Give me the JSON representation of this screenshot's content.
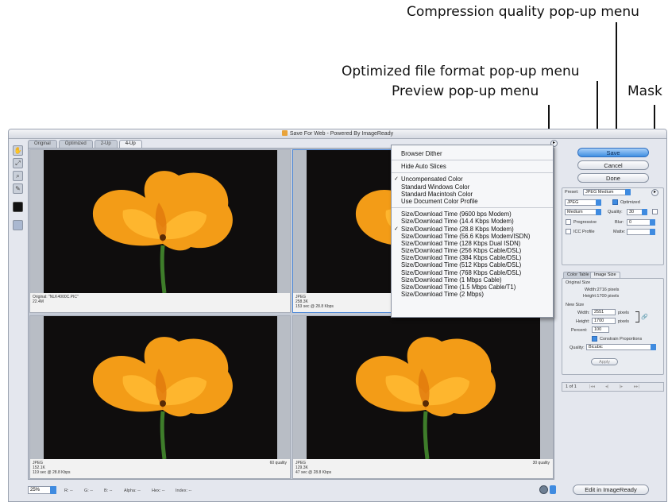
{
  "callouts": {
    "compression": "Compression quality pop-up menu",
    "format": "Optimized file format pop-up menu",
    "preview": "Preview pop-up menu",
    "mask": "Mask"
  },
  "window": {
    "title": "Save For Web - Powered By ImageReady"
  },
  "tabs": [
    "Original",
    "Optimized",
    "2-Up",
    "4-Up"
  ],
  "active_tab": "4-Up",
  "panes": [
    {
      "info_lines": [
        "Original: \"NLK4000C.PIC\"",
        "22.4M"
      ],
      "quality": ""
    },
    {
      "info_lines": [
        "JPEG",
        "258.3K",
        "153 sec @ 28.8 Kbps"
      ],
      "quality": ""
    },
    {
      "info_lines": [
        "JPEG",
        "152.1K",
        "119 sec @ 28.8 Kbps"
      ],
      "quality": "60 quality"
    },
    {
      "info_lines": [
        "JPEG",
        "129.3K",
        "47 sec @ 28.8 Kbps"
      ],
      "quality": "30 quality"
    }
  ],
  "preview_menu": {
    "group1": [
      {
        "label": "Browser Dither",
        "checked": false
      }
    ],
    "group2": [
      {
        "label": "Hide Auto Slices",
        "checked": false
      }
    ],
    "group3": [
      {
        "label": "Uncompensated Color",
        "checked": true
      },
      {
        "label": "Standard Windows Color",
        "checked": false
      },
      {
        "label": "Standard Macintosh Color",
        "checked": false
      },
      {
        "label": "Use Document Color Profile",
        "checked": false
      }
    ],
    "group4": [
      {
        "label": "Size/Download Time (9600 bps Modem)",
        "checked": false
      },
      {
        "label": "Size/Download Time (14.4 Kbps Modem)",
        "checked": false
      },
      {
        "label": "Size/Download Time (28.8 Kbps Modem)",
        "checked": true
      },
      {
        "label": "Size/Download Time (56.6 Kbps Modem/ISDN)",
        "checked": false
      },
      {
        "label": "Size/Download Time (128 Kbps Dual ISDN)",
        "checked": false
      },
      {
        "label": "Size/Download Time (256 Kbps Cable/DSL)",
        "checked": false
      },
      {
        "label": "Size/Download Time (384 Kbps Cable/DSL)",
        "checked": false
      },
      {
        "label": "Size/Download Time (512 Kbps Cable/DSL)",
        "checked": false
      },
      {
        "label": "Size/Download Time (768 Kbps Cable/DSL)",
        "checked": false
      },
      {
        "label": "Size/Download Time (1 Mbps Cable)",
        "checked": false
      },
      {
        "label": "Size/Download Time (1.5 Mbps Cable/T1)",
        "checked": false
      },
      {
        "label": "Size/Download Time (2 Mbps)",
        "checked": false
      }
    ]
  },
  "buttons": {
    "save": "Save",
    "cancel": "Cancel",
    "done": "Done",
    "edit": "Edit in ImageReady"
  },
  "settings": {
    "preset_label": "Preset:",
    "preset_value": "JPEG Medium",
    "format_value": "JPEG",
    "optimized_label": "Optimized",
    "quality_mode": "Medium",
    "quality_label": "Quality:",
    "quality_value": "30",
    "progressive_label": "Progressive",
    "blur_label": "Blur:",
    "blur_value": "0",
    "icc_label": "ICC Profile",
    "matte_label": "Matte:"
  },
  "image_size": {
    "tabs": [
      "Color Table",
      "Image Size"
    ],
    "original_size_label": "Original Size",
    "orig_width": "Width:2716 pixels",
    "orig_height": "Height:1700 pixels",
    "new_size_label": "New Size",
    "width_label": "Width:",
    "width_value": "2551",
    "height_label": "Height:",
    "height_value": "1700",
    "units": "pixels",
    "percent_label": "Percent:",
    "percent_value": "100",
    "constrain_label": "Constrain Proportions",
    "quality_label": "Quality:",
    "quality_value": "Bicubic",
    "apply_label": "Apply"
  },
  "slice_nav": {
    "counter": "1 of 1"
  },
  "bottom_bar": {
    "zoom": "25%",
    "r": "R: --",
    "g": "G: --",
    "b": "B: --",
    "alpha": "Alpha: --",
    "hex": "Hex: --",
    "index": "Index: --"
  },
  "colors": {
    "accent": "#3f8be0",
    "petal": "#f5a21c",
    "background": "#0f0d0d"
  }
}
